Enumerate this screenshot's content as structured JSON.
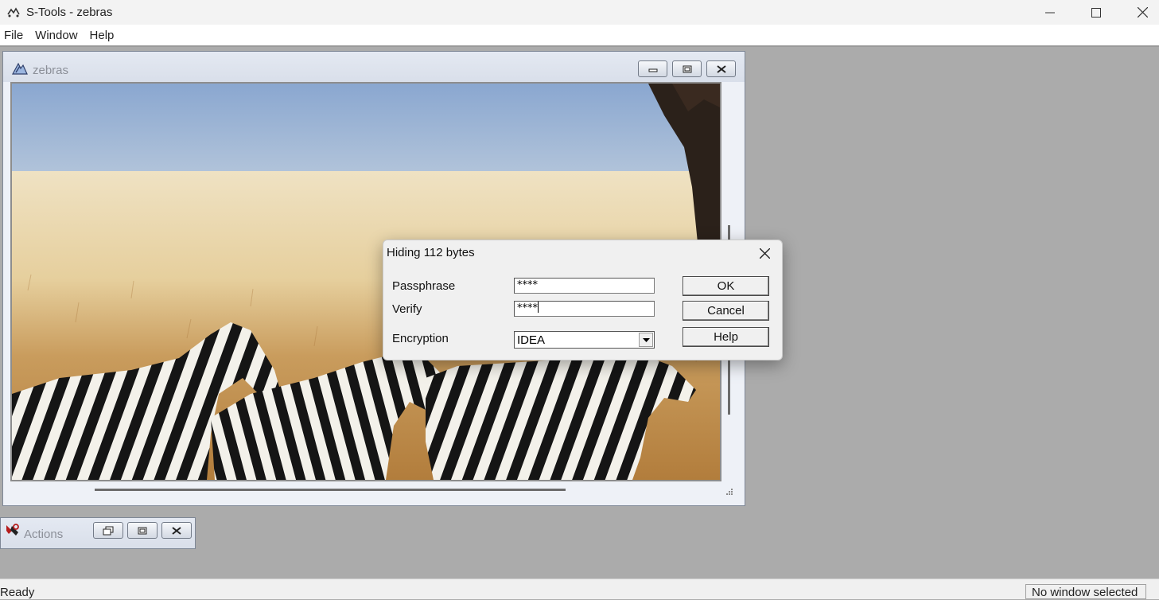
{
  "app": {
    "title": "S-Tools - zebras",
    "icon": "s-tools-icon"
  },
  "window_controls": {
    "minimize_icon": "minimize-icon",
    "maximize_icon": "maximize-icon",
    "close_icon": "close-icon"
  },
  "menu": {
    "items": [
      "File",
      "Window",
      "Help"
    ]
  },
  "child_window": {
    "title": "zebras",
    "icon": "picture-tool-icon",
    "buttons": [
      "minimize-icon",
      "restore-icon",
      "close-icon"
    ],
    "image": "zebras-photo"
  },
  "actions_window": {
    "title": "Actions",
    "icon": "tools-icon",
    "buttons": [
      "restore-icon",
      "maximize-icon",
      "close-icon"
    ]
  },
  "dialog": {
    "title": "Hiding 112 bytes",
    "passphrase_label": "Passphrase",
    "passphrase_value": "****",
    "verify_label": "Verify",
    "verify_value": "****",
    "encryption_label": "Encryption",
    "encryption_value": "IDEA",
    "ok_label": "OK",
    "cancel_label": "Cancel",
    "help_label": "Help"
  },
  "status": {
    "left_text": "Ready",
    "right_text": "No window selected"
  },
  "colors": {
    "workspace": "#ababab",
    "dialog_bg": "#f0f0f0",
    "mdi_title": "#dde3ec"
  }
}
